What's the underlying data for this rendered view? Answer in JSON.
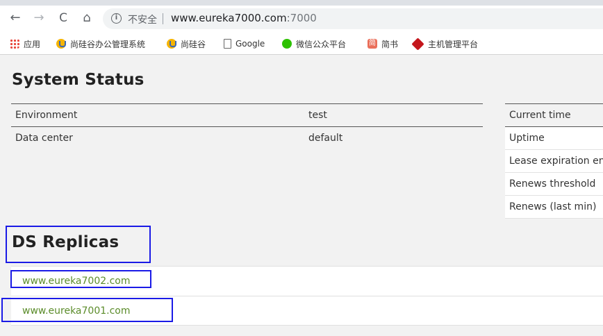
{
  "browser": {
    "nav": {
      "back": "←",
      "forward": "→",
      "reload": "C",
      "home": "⌂"
    },
    "security_label": "不安全",
    "url_host": "www.eureka7000.com",
    "url_port": ":7000"
  },
  "bookmarks": [
    {
      "label": "应用",
      "icon": "apps-grid-icon"
    },
    {
      "label": "尚硅谷办公管理系统",
      "icon": "atguigu-icon"
    },
    {
      "label": "尚硅谷",
      "icon": "atguigu-icon"
    },
    {
      "label": "Google",
      "icon": "page-icon"
    },
    {
      "label": "微信公众平台",
      "icon": "wechat-icon"
    },
    {
      "label": "简书",
      "icon": "jianshu-icon",
      "icon_text": "简"
    },
    {
      "label": "主机管理平台",
      "icon": "host-icon"
    }
  ],
  "system_status": {
    "title": "System Status",
    "rows": [
      {
        "label": "Environment",
        "value": "test"
      },
      {
        "label": "Data center",
        "value": "default"
      }
    ],
    "right_rows": [
      {
        "label": "Current time"
      },
      {
        "label": "Uptime"
      },
      {
        "label": "Lease expiration en"
      },
      {
        "label": "Renews threshold"
      },
      {
        "label": "Renews (last min)"
      }
    ]
  },
  "ds_replicas": {
    "title": "DS Replicas",
    "items": [
      {
        "label": "www.eureka7002.com"
      },
      {
        "label": "www.eureka7001.com"
      }
    ]
  },
  "colors": {
    "link": "#5b8c2a",
    "annotation": "#1a1ae6",
    "background": "#f2f2f2"
  }
}
